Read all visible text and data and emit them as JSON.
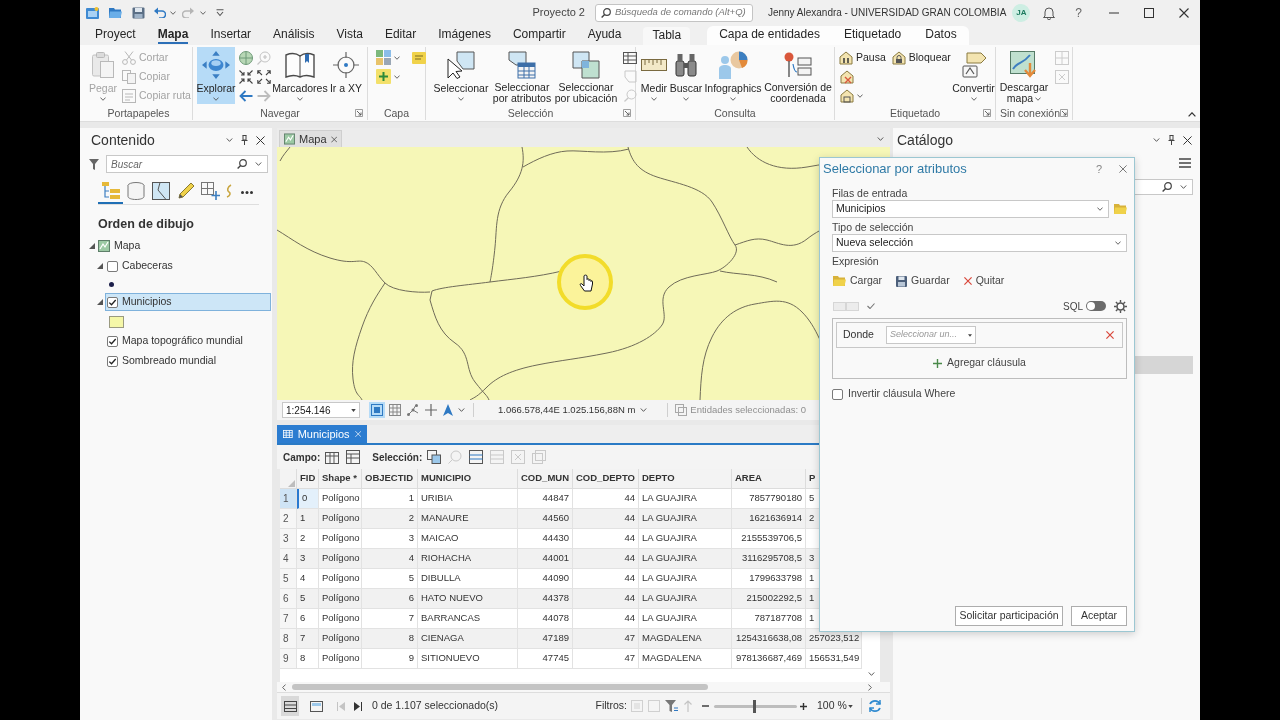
{
  "title_bar": {
    "project": "Proyecto 2",
    "command_search": {
      "placeholder": "Búsqueda de comando (Alt+Q)"
    },
    "user": "Jenny Alexandra - UNIVERSIDAD GRAN COLOMBIA",
    "avatar": "JA",
    "help": "?"
  },
  "ribbon_tabs": [
    {
      "label": "Proyect",
      "selected": false
    },
    {
      "label": "Mapa",
      "selected": true
    },
    {
      "label": "Insertar",
      "selected": false
    },
    {
      "label": "Análisis",
      "selected": false
    },
    {
      "label": "Vista",
      "selected": false
    },
    {
      "label": "Editar",
      "selected": false
    },
    {
      "label": "Imágenes",
      "selected": false
    },
    {
      "label": "Compartir",
      "selected": false
    },
    {
      "label": "Ayuda",
      "selected": false
    }
  ],
  "contextual_tab_groups": [
    {
      "tabs": [
        {
          "label": "Tabla",
          "selected": false
        }
      ]
    },
    {
      "tabs": [
        {
          "label": "Capa de entidades",
          "selected": false
        },
        {
          "label": "Etiquetado",
          "selected": false
        },
        {
          "label": "Datos",
          "selected": false
        }
      ]
    }
  ],
  "ribbon_groups": [
    {
      "label": "Portapapeles",
      "launcher": false,
      "items": [
        {
          "label": "Pegar",
          "disabled": true,
          "active": false
        },
        {
          "label": "Cortar",
          "disabled": true,
          "active": false
        },
        {
          "label": "Copiar",
          "disabled": true,
          "active": false
        },
        {
          "label": "Copiar ruta",
          "disabled": true,
          "active": false
        }
      ]
    },
    {
      "label": "Navegar",
      "launcher": true,
      "items": [
        {
          "label": "Explorar",
          "disabled": false,
          "active": true
        },
        {
          "label": "Marcadores",
          "disabled": false,
          "active": false
        },
        {
          "label": "Ir a XY",
          "disabled": false,
          "active": false
        }
      ]
    },
    {
      "label": "Capa",
      "launcher": false
    },
    {
      "label": "Selección",
      "launcher": true,
      "items": [
        {
          "label": "Seleccionar",
          "disabled": false,
          "active": false
        },
        {
          "label": "Seleccionar por atributos",
          "disabled": false,
          "active": false
        },
        {
          "label": "Seleccionar por ubicación",
          "disabled": false,
          "active": false
        }
      ]
    },
    {
      "label": "Consulta",
      "launcher": false,
      "items": [
        {
          "label": "Medir",
          "disabled": false,
          "active": false
        },
        {
          "label": "Buscar",
          "disabled": false,
          "active": false
        },
        {
          "label": "Infographics",
          "disabled": false,
          "active": false
        },
        {
          "label": "Conversión de coordenada",
          "disabled": false,
          "active": false
        }
      ]
    },
    {
      "label": "Etiquetado",
      "launcher": true,
      "items": [
        {
          "label": "Pausa",
          "disabled": false,
          "active": false
        },
        {
          "label": "Bloquear",
          "disabled": false,
          "active": false
        },
        {
          "label": "Convertir",
          "disabled": false,
          "active": false
        }
      ]
    },
    {
      "label": "Sin conexión",
      "launcher": true,
      "items": [
        {
          "label": "Descargar mapa",
          "disabled": false,
          "active": false
        }
      ]
    }
  ],
  "contents_pane": {
    "title": "Contenido",
    "search": {
      "placeholder": "Buscar"
    },
    "views": [
      {
        "selected": true
      },
      {
        "selected": false
      },
      {
        "selected": false
      },
      {
        "selected": false
      },
      {
        "selected": false
      },
      {
        "selected": false
      }
    ],
    "heading": "Orden de dibujo",
    "tree": [
      {
        "label": "Mapa",
        "expanded": true,
        "selected": false,
        "children": [
          {
            "label": "Cabeceras",
            "expanded": true,
            "checked": false,
            "selected": false,
            "symbol": {
              "kind": "point"
            }
          },
          {
            "label": "Municipios",
            "expanded": true,
            "checked": true,
            "selected": true,
            "symbol": {
              "kind": "polygon"
            }
          },
          {
            "label": "Mapa topográfico mundial",
            "checked": true,
            "selected": false
          },
          {
            "label": "Sombreado mundial",
            "checked": true,
            "selected": false
          }
        ]
      }
    ]
  },
  "map_view": {
    "tab": "Mapa",
    "status_bar": {
      "scale": "1:254.146",
      "coordinates": "1.066.578,44E 1.025.156,88N m",
      "selection_count": "Entidades seleccionadas: 0"
    }
  },
  "table_view": {
    "tab": "Municipios",
    "field_label": "Campo:",
    "selection_label": "Selección:",
    "columns": [
      "FID",
      "Shape *",
      "OBJECTID",
      "MUNICIPIO",
      "COD_MUN",
      "COD_DEPTO",
      "DEPTO",
      "AREA",
      "P"
    ],
    "rows": [
      {
        "number": "1",
        "current": true,
        "cells": [
          "0",
          "Polígono",
          "1",
          "URIBIA",
          "44847",
          "44",
          "LA GUAJIRA",
          "7857790180",
          "5"
        ]
      },
      {
        "number": "2",
        "current": false,
        "cells": [
          "1",
          "Polígono",
          "2",
          "MANAURE",
          "44560",
          "44",
          "LA GUAJIRA",
          "1621636914",
          "2"
        ]
      },
      {
        "number": "3",
        "current": false,
        "cells": [
          "2",
          "Polígono",
          "3",
          "MAICAO",
          "44430",
          "44",
          "LA GUAJIRA",
          "2155539706,5"
        ]
      },
      {
        "number": "4",
        "current": false,
        "cells": [
          "3",
          "Polígono",
          "4",
          "RIOHACHA",
          "44001",
          "44",
          "LA GUAJIRA",
          "3116295708,5",
          "3"
        ]
      },
      {
        "number": "5",
        "current": false,
        "cells": [
          "4",
          "Polígono",
          "5",
          "DIBULLA",
          "44090",
          "44",
          "LA GUAJIRA",
          "1799633798",
          "1"
        ]
      },
      {
        "number": "6",
        "current": false,
        "cells": [
          "5",
          "Polígono",
          "6",
          "HATO NUEVO",
          "44378",
          "44",
          "LA GUAJIRA",
          "215002292,5",
          "1"
        ]
      },
      {
        "number": "7",
        "current": false,
        "cells": [
          "6",
          "Polígono",
          "7",
          "BARRANCAS",
          "44078",
          "44",
          "LA GUAJIRA",
          "787187708",
          "1"
        ]
      },
      {
        "number": "8",
        "current": false,
        "cells": [
          "7",
          "Polígono",
          "8",
          "CIENAGA",
          "47189",
          "47",
          "MAGDALENA",
          "1254316638,08",
          "257023,512"
        ]
      },
      {
        "number": "9",
        "current": false,
        "cells": [
          "8",
          "Polígono",
          "9",
          "SITIONUEVO",
          "47745",
          "47",
          "MAGDALENA",
          "978136687,469",
          "156531,549"
        ]
      }
    ],
    "record_status": "0 de 1.107 seleccionado(s)",
    "filters_label": "Filtros:",
    "zoom": {
      "level": 0.48,
      "value": "100 %"
    }
  },
  "catalog_pane": {
    "title": "Catálogo"
  },
  "dialog": {
    "title": "Seleccionar por atributos",
    "help": "?",
    "input_rows": {
      "label": "Filas de entrada",
      "value": "Municipios"
    },
    "selection_type": {
      "label": "Tipo de selección",
      "value": "Nueva selección"
    },
    "expression": {
      "label": "Expresión",
      "actions": [
        "Cargar",
        "Guardar",
        "Quitar"
      ],
      "sql": {
        "label": "SQL",
        "on": false
      },
      "clauses": [
        {
          "label": "Donde",
          "field": {
            "placeholder": "Seleccionar un..."
          }
        }
      ],
      "add_clause": "Agregar cláusula"
    },
    "invert_where": {
      "label": "Invertir cláusula Where",
      "checked": false
    },
    "buttons": [
      "Solicitar participación",
      "Aceptar"
    ]
  }
}
